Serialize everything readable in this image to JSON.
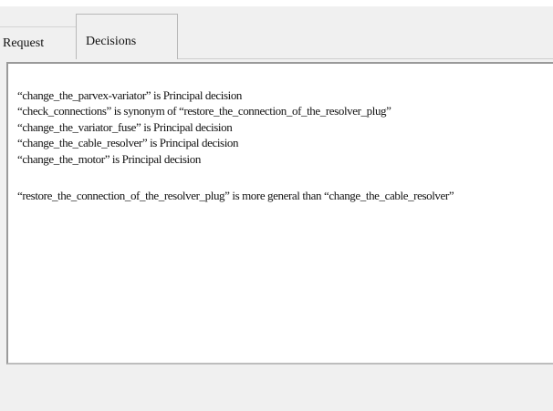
{
  "tabs": [
    {
      "label": "Request"
    },
    {
      "label": "Decisions"
    }
  ],
  "decisions": {
    "lines": [
      "“change_the_parvex-variator” is Principal decision",
      "“check_connections” is synonym of “restore_the_connection_of_the_resolver_plug”",
      "“change_the_variator_fuse” is Principal decision",
      "“change_the_cable_resolver” is Principal decision",
      "“change_the_motor” is Principal decision"
    ],
    "relation": "“restore_the_connection_of_the_resolver_plug” is more general than “change_the_cable_resolver”"
  }
}
